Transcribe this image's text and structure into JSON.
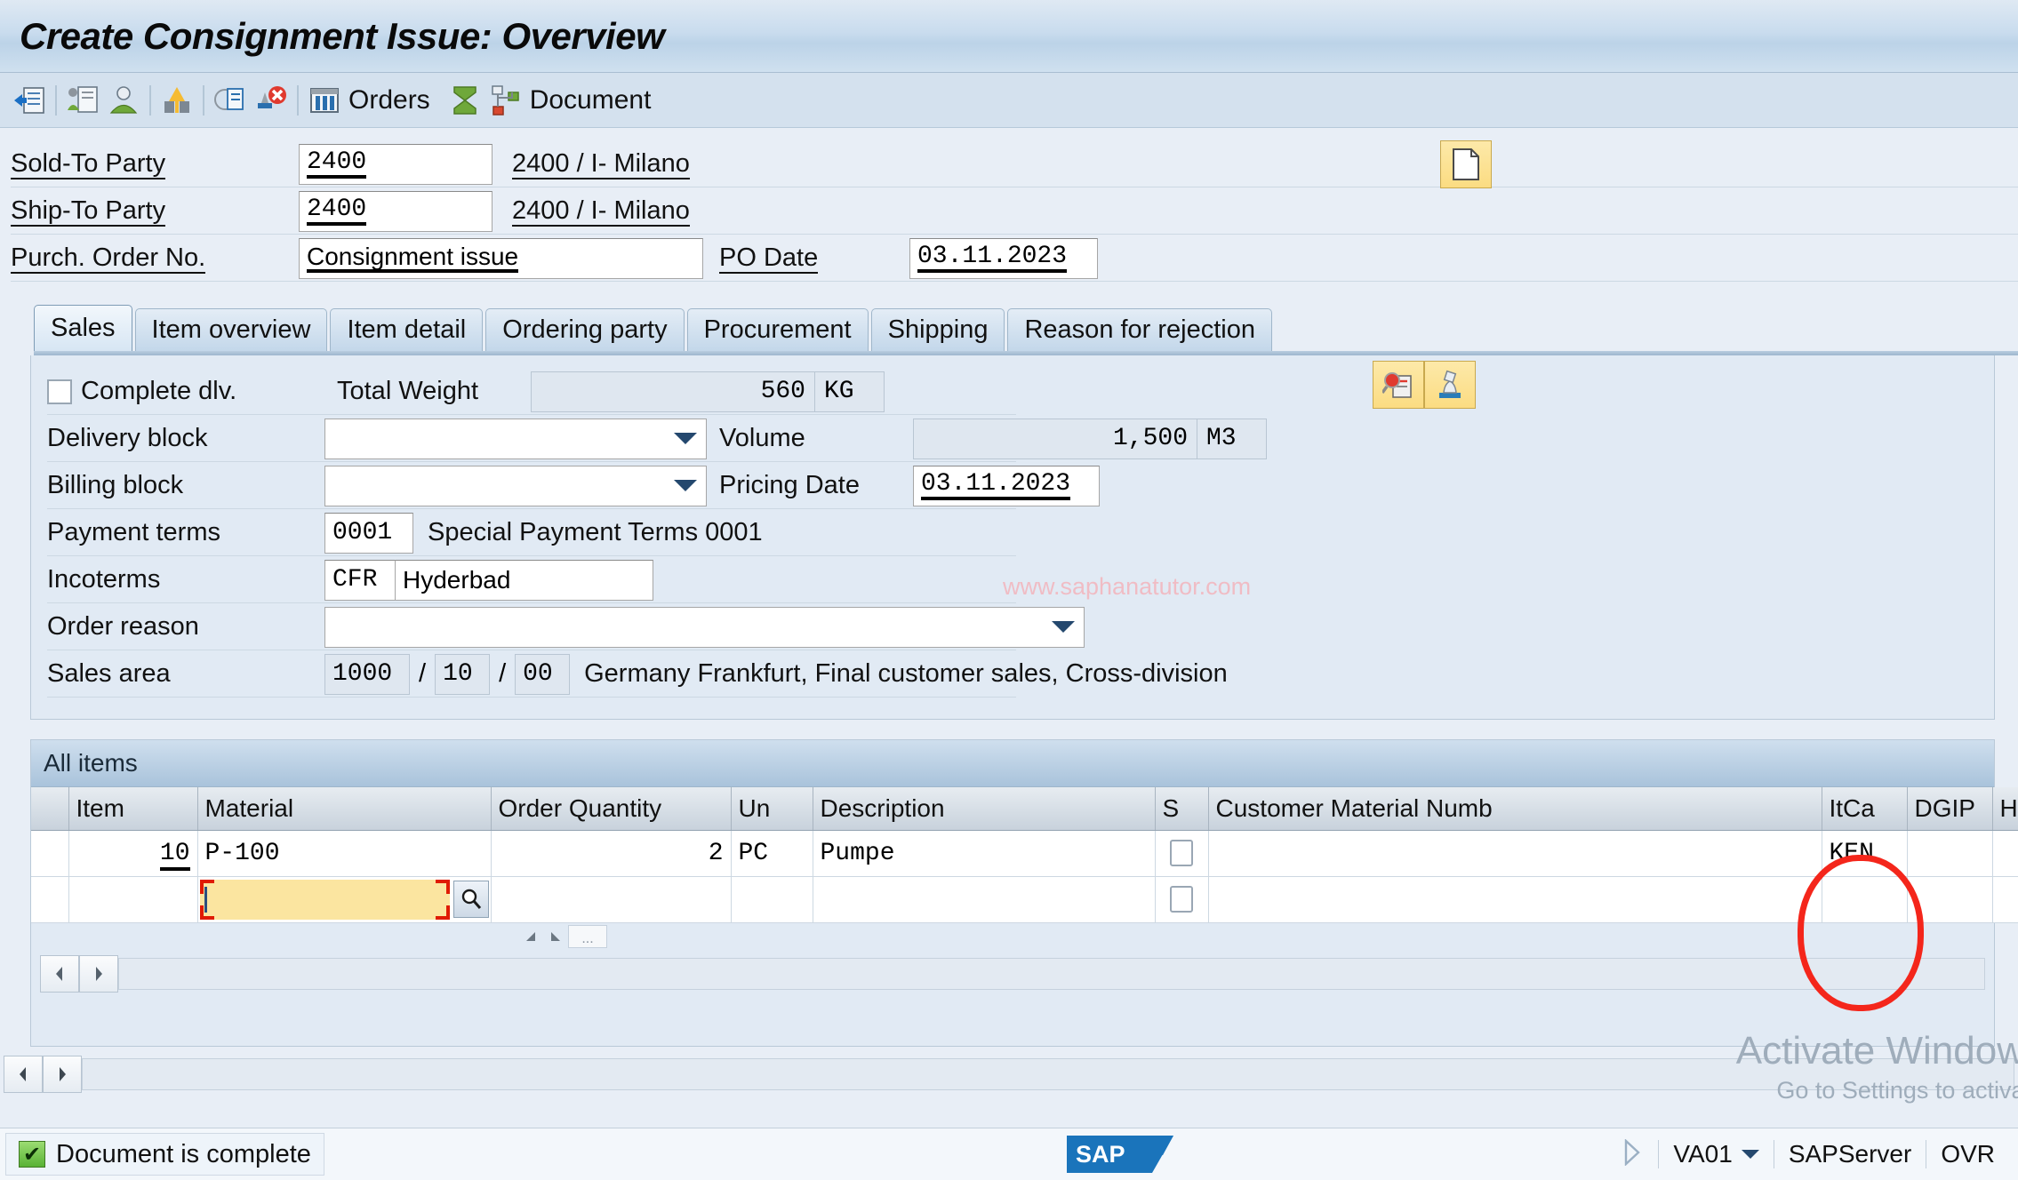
{
  "window": {
    "title": "Create Consignment Issue: Overview"
  },
  "toolbar": {
    "buttons": [
      {
        "name": "enter-icon",
        "label": ""
      },
      {
        "name": "create-with-reference-icon",
        "label": ""
      },
      {
        "name": "partner-icon",
        "label": ""
      },
      {
        "name": "incompletion-log-icon",
        "label": ""
      },
      {
        "name": "display-document-icon",
        "label": ""
      },
      {
        "name": "reject-document-icon",
        "label": ""
      }
    ],
    "orders_label": "Orders",
    "document_label": "Document"
  },
  "header": {
    "fields": [
      {
        "label": "Sold-To Party",
        "value": "2400",
        "description": "2400 / I- Milano"
      },
      {
        "label": "Ship-To Party",
        "value": "2400",
        "description": "2400 / I- Milano"
      }
    ],
    "purch_order_label": "Purch. Order No.",
    "purch_order_value": "Consignment issue",
    "po_date_label": "PO Date",
    "po_date_value": "03.11.2023",
    "icons": {
      "document_button": "document-icon",
      "search_button": "search-document-icon",
      "stamp_button": "stamp-icon"
    }
  },
  "tabs": [
    {
      "label": "Sales",
      "active": true
    },
    {
      "label": "Item overview",
      "active": false
    },
    {
      "label": "Item detail",
      "active": false
    },
    {
      "label": "Ordering party",
      "active": false
    },
    {
      "label": "Procurement",
      "active": false
    },
    {
      "label": "Shipping",
      "active": false
    },
    {
      "label": "Reason for rejection",
      "active": false
    }
  ],
  "sales": {
    "complete_dlv_label": "Complete dlv.",
    "complete_dlv_checked": false,
    "delivery_block_label": "Delivery block",
    "delivery_block_value": "",
    "billing_block_label": "Billing block",
    "billing_block_value": "",
    "payment_terms_label": "Payment terms",
    "payment_terms_code": "0001",
    "payment_terms_text": "Special Payment Terms 0001",
    "incoterms_label": "Incoterms",
    "incoterms_code": "CFR",
    "incoterms_text": "Hyderbad",
    "order_reason_label": "Order reason",
    "order_reason_value": "",
    "sales_area_label": "Sales area",
    "sales_area_1": "1000",
    "sales_area_2": "10",
    "sales_area_3": "00",
    "sales_area_sep": "/",
    "sales_area_text": "Germany Frankfurt, Final customer sales, Cross-division",
    "total_weight_label": "Total Weight",
    "total_weight_value": "560",
    "total_weight_unit": "KG",
    "volume_label": "Volume",
    "volume_value": "1,500",
    "volume_unit": "M3",
    "pricing_date_label": "Pricing Date",
    "pricing_date_value": "03.11.2023"
  },
  "items": {
    "title": "All items",
    "columns": [
      "",
      "Item",
      "Material",
      "Order Quantity",
      "Un",
      "Description",
      "S",
      "Customer Material Numb",
      "ItCa",
      "DGIP",
      "HI"
    ],
    "rows": [
      {
        "item": "10",
        "material": "P-100",
        "order_quantity": "2",
        "un": "PC",
        "description": "Pumpe",
        "customer_material": "",
        "itca": "KEN",
        "dgip": "",
        "hl": ""
      },
      {
        "item": "",
        "material": "",
        "order_quantity": "",
        "un": "",
        "description": "",
        "customer_material": "",
        "itca": "",
        "dgip": "",
        "hl": ""
      }
    ]
  },
  "annotation": {
    "color": "#f4261b",
    "target": "ItCa"
  },
  "watermark": {
    "text": "www.saphanatutor.com"
  },
  "windows_activation": {
    "line1": "Activate Windows",
    "line2": "Go to Settings to activate"
  },
  "statusbar": {
    "message": "Document is complete",
    "transaction": "VA01",
    "server": "SAPServer",
    "mode": "OVR",
    "logo": "SAP"
  }
}
